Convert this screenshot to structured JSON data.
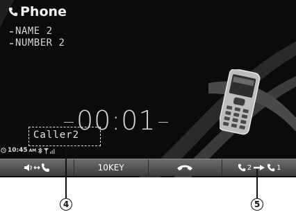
{
  "screen": {
    "title": "Phone",
    "name_line": "NAME 2",
    "number_line": "NUMBER 2",
    "timer": "00:01",
    "caller": "Caller2",
    "clock": "10:45",
    "ampm": "AM"
  },
  "buttons": [
    {
      "label": "",
      "icon": "volume-transfer-icon"
    },
    {
      "label": "10KEY"
    },
    {
      "label": "",
      "icon": "hang-up-icon"
    },
    {
      "label_a": "2",
      "label_b": "1",
      "icon": "line-switch-icon"
    }
  ],
  "callouts": {
    "left": "4",
    "right": "5"
  }
}
